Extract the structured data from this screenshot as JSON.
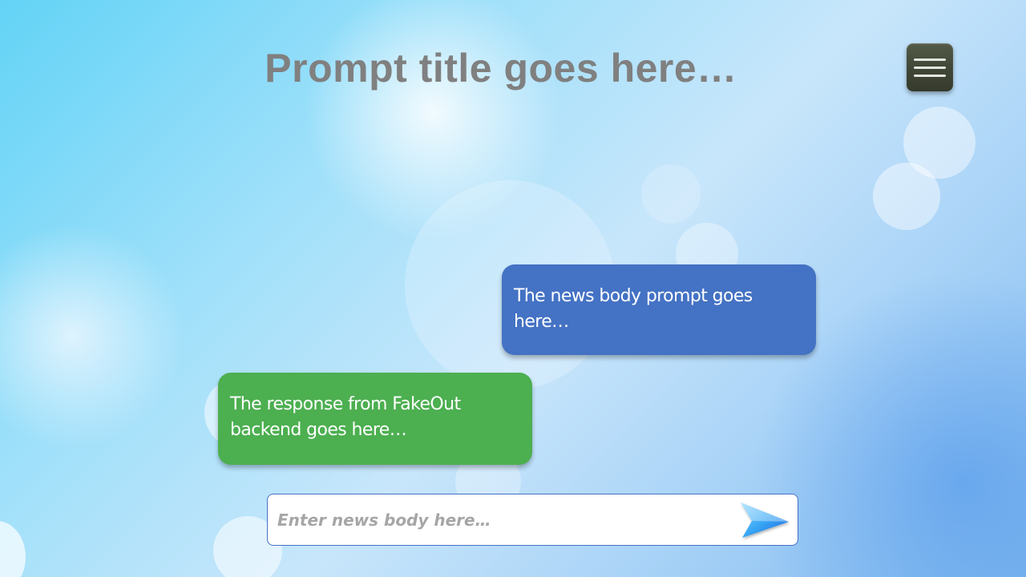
{
  "header": {
    "title": "Prompt title goes here…",
    "menu_icon": "hamburger-menu-icon"
  },
  "chat": {
    "prompt_message": "The news body prompt goes here…",
    "response_message": "The response from FakeOut backend goes here…"
  },
  "composer": {
    "placeholder": "Enter news body here…",
    "value": "",
    "send_icon": "send-arrow-icon"
  },
  "colors": {
    "prompt_bubble": "#4472c4",
    "response_bubble": "#4caf50",
    "title_text": "#808080",
    "menu_button": "#424838"
  }
}
